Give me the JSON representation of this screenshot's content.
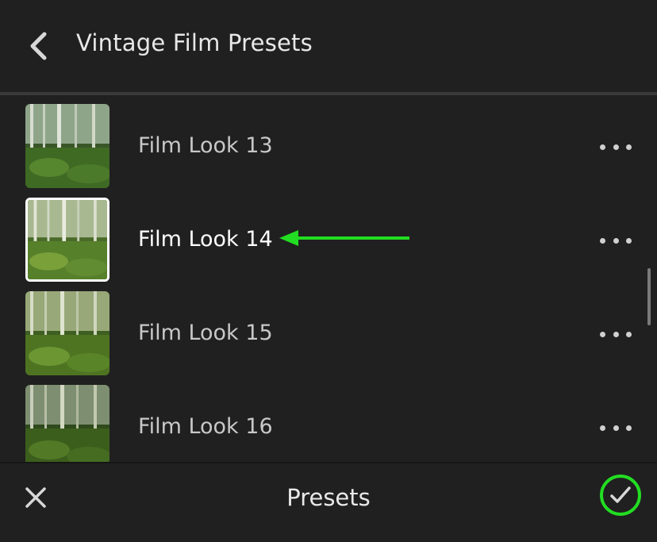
{
  "header": {
    "title": "Vintage Film Presets",
    "back_icon": "chevron-left-icon"
  },
  "presets": [
    {
      "label": "Film Look 13",
      "selected": false
    },
    {
      "label": "Film Look 14",
      "selected": true
    },
    {
      "label": "Film Look 15",
      "selected": false
    },
    {
      "label": "Film Look 16",
      "selected": false
    }
  ],
  "annotation": {
    "icon": "arrow-left-icon",
    "color": "#22dd22"
  },
  "footer": {
    "title": "Presets",
    "cancel_icon": "close-icon",
    "confirm_icon": "checkmark-icon",
    "confirm_color": "#22dd22"
  }
}
